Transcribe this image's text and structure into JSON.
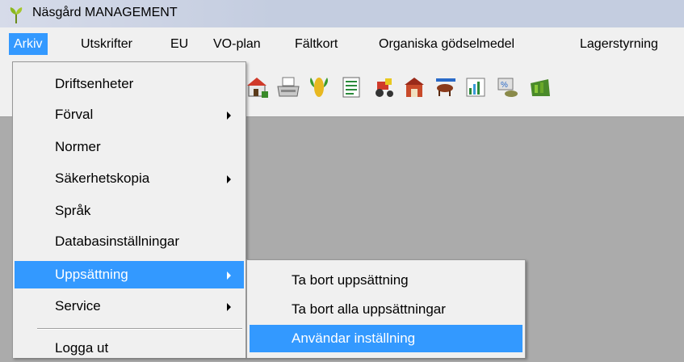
{
  "window": {
    "title": "Näsgård MANAGEMENT",
    "icon": "leaf-icon"
  },
  "menubar": {
    "items": [
      {
        "label": "Arkiv",
        "active": true
      },
      {
        "label": "Utskrifter"
      },
      {
        "label": "EU"
      },
      {
        "label": "VO-plan"
      },
      {
        "label": "Fältkort"
      },
      {
        "label": "Organiska gödselmedel"
      },
      {
        "label": "Lagerstyrning"
      }
    ]
  },
  "toolbar": {
    "icons": [
      "house-icon",
      "printer-icon",
      "corn-icon",
      "document-icon",
      "tractor-icon",
      "barn-icon",
      "cattle-icon",
      "chart-icon",
      "money-icon",
      "field-icon"
    ]
  },
  "arkiv_menu": {
    "items": [
      {
        "label": "Driftsenheter"
      },
      {
        "label": "Förval",
        "submenu": true
      },
      {
        "label": "Normer"
      },
      {
        "label": "Säkerhetskopia",
        "submenu": true
      },
      {
        "label": "Språk"
      },
      {
        "label": "Databasinställningar"
      },
      {
        "label": "Uppsättning",
        "submenu": true,
        "active": true
      },
      {
        "label": "Service",
        "submenu": true
      },
      {
        "label": "Logga ut"
      }
    ]
  },
  "uppsattning_submenu": {
    "items": [
      {
        "label": "Ta bort uppsättning"
      },
      {
        "label": "Ta bort alla uppsättningar"
      },
      {
        "label": "Användar inställning",
        "active": true
      }
    ]
  },
  "colors": {
    "highlight": "#3399ff",
    "menu_background": "#f0f0f0",
    "workspace": "#ababab"
  }
}
